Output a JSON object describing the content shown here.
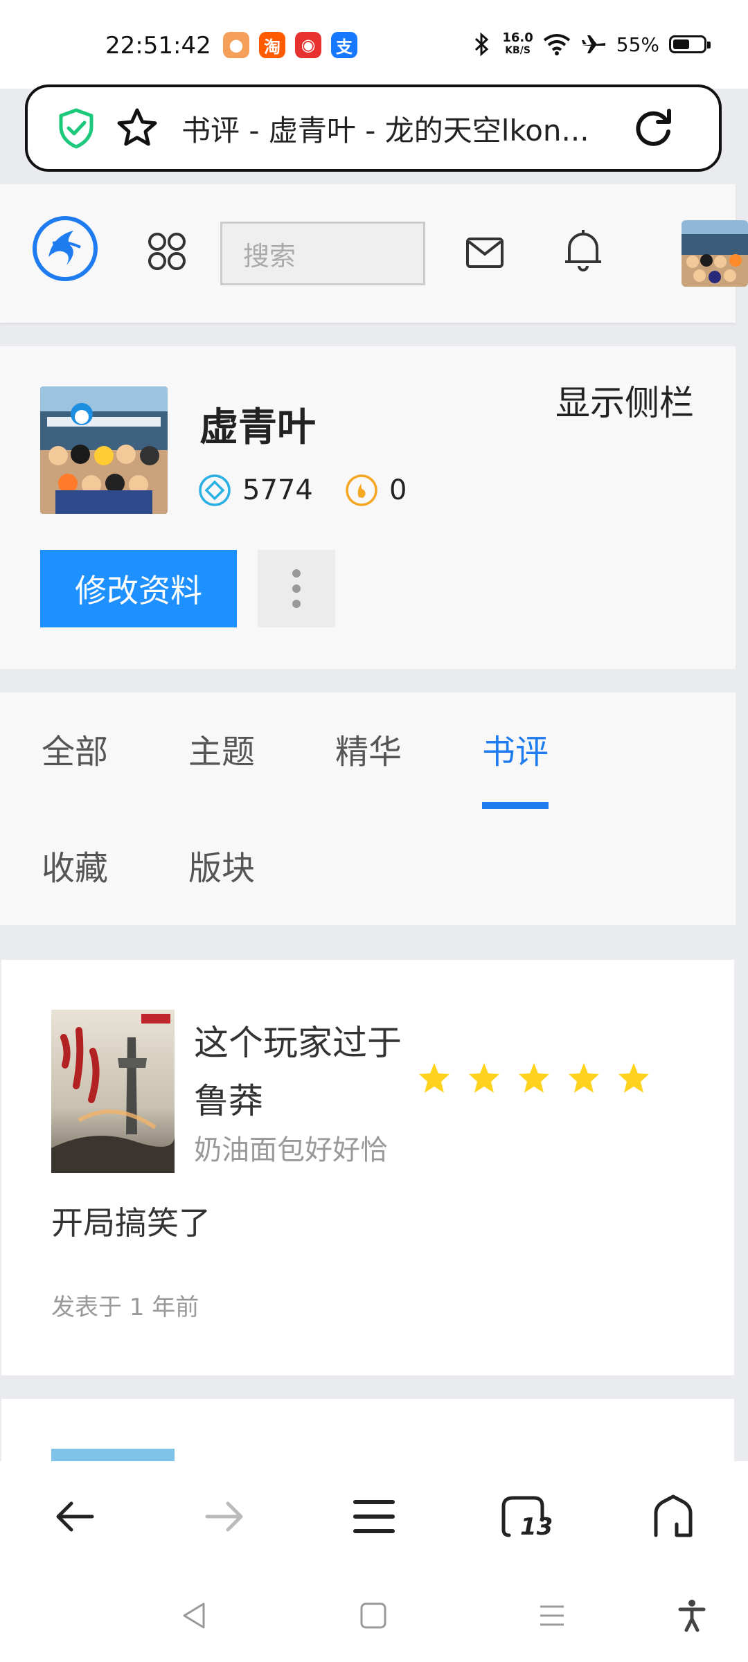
{
  "status_bar": {
    "time": "22:51:42",
    "apps": [
      {
        "icon": "app-mascot-icon",
        "label": "",
        "color": "#f5a05a"
      },
      {
        "icon": "taobao-icon",
        "label": "淘",
        "color": "#ff5a00"
      },
      {
        "icon": "app-red-icon",
        "label": "",
        "color": "#e8322f"
      },
      {
        "icon": "alipay-icon",
        "label": "支",
        "color": "#1677ff"
      }
    ],
    "net_speed_value": "16.0",
    "net_speed_unit": "KB/S",
    "battery": "55%",
    "battery_level": 0.55
  },
  "browser": {
    "url_title": "书评 - 虚青叶 - 龙的天空lkon..."
  },
  "header": {
    "search_placeholder": "搜索"
  },
  "profile": {
    "name": "虚青叶",
    "show_sidebar": "显示侧栏",
    "points": "5774",
    "coins": "0",
    "edit_button": "修改资料"
  },
  "tabs": [
    {
      "label": "全部",
      "active": false
    },
    {
      "label": "主题",
      "active": false
    },
    {
      "label": "精华",
      "active": false
    },
    {
      "label": "书评",
      "active": true
    },
    {
      "label": "收藏",
      "active": false
    },
    {
      "label": "版块",
      "active": false
    }
  ],
  "review": {
    "book_title": "这个玩家过于鲁莽",
    "author": "奶油面包好好恰",
    "rating": 5,
    "text": "开局搞笑了",
    "time": "发表于 1 年前"
  },
  "browser_nav": {
    "tab_count": "13"
  },
  "colors": {
    "accent": "#1e7cf0",
    "button": "#1e90ff",
    "star": "#ffd21e"
  }
}
